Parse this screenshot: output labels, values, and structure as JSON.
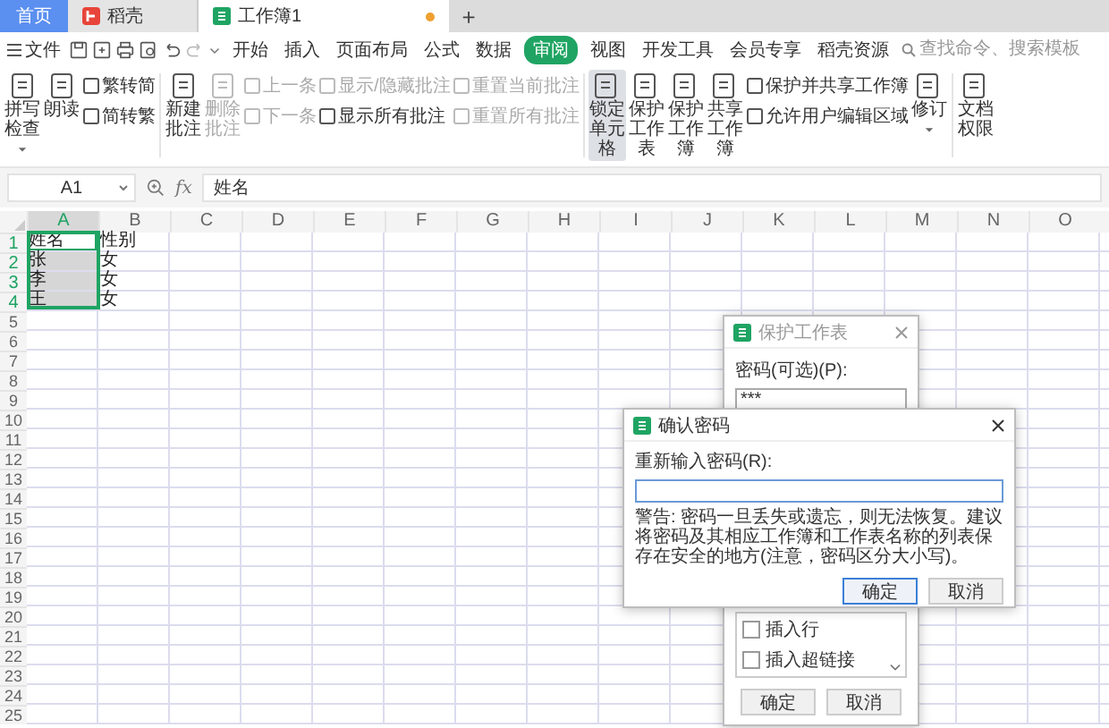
{
  "tabs": [
    {
      "label": "首页",
      "selected": false,
      "kind": "home"
    },
    {
      "label": "稻壳",
      "selected": false,
      "kind": "docer"
    },
    {
      "label": "工作簿1",
      "selected": true,
      "kind": "sheet",
      "unsaved": true
    }
  ],
  "new_tab": "+",
  "menu": {
    "file": "文件",
    "items": [
      {
        "label": "开始",
        "selected": false
      },
      {
        "label": "插入",
        "selected": false
      },
      {
        "label": "页面布局",
        "selected": false
      },
      {
        "label": "公式",
        "selected": false
      },
      {
        "label": "数据",
        "selected": false
      },
      {
        "label": "审阅",
        "selected": true
      },
      {
        "label": "视图",
        "selected": false
      },
      {
        "label": "开发工具",
        "selected": false
      },
      {
        "label": "会员专享",
        "selected": false
      },
      {
        "label": "稻壳资源",
        "selected": false
      }
    ],
    "search": {
      "placeholder": "查找命令、搜索模板"
    }
  },
  "ribbon": [
    {
      "items": [
        {
          "kind": "large",
          "label": "拼写检查",
          "dropdown": true,
          "disabled": false,
          "selected": false
        },
        {
          "kind": "large",
          "label": "朗读",
          "dropdown": false,
          "disabled": false,
          "selected": false
        },
        {
          "kind": "pair",
          "items": [
            {
              "label": "繁转简",
              "disabled": false
            },
            {
              "label": "简转繁",
              "disabled": false
            }
          ]
        }
      ]
    },
    {
      "items": [
        {
          "kind": "large",
          "label": "新建批注",
          "dropdown": false,
          "disabled": false,
          "selected": false
        },
        {
          "kind": "large",
          "label": "删除批注",
          "dropdown": false,
          "disabled": true,
          "selected": false
        },
        {
          "kind": "pair",
          "items": [
            {
              "label": "上一条",
              "disabled": true
            },
            {
              "label": "下一条",
              "disabled": true
            }
          ]
        },
        {
          "kind": "pair",
          "items": [
            {
              "label": "显示/隐藏批注",
              "disabled": true
            },
            {
              "label": "显示所有批注",
              "disabled": false
            }
          ]
        },
        {
          "kind": "pair",
          "items": [
            {
              "label": "重置当前批注",
              "disabled": true
            },
            {
              "label": "重置所有批注",
              "disabled": true
            }
          ]
        }
      ]
    },
    {
      "items": [
        {
          "kind": "large",
          "label": "锁定单元格",
          "dropdown": false,
          "disabled": false,
          "selected": true
        },
        {
          "kind": "large",
          "label": "保护工作表",
          "dropdown": false,
          "disabled": false,
          "selected": false
        },
        {
          "kind": "large",
          "label": "保护工作簿",
          "dropdown": false,
          "disabled": false,
          "selected": false
        },
        {
          "kind": "large",
          "label": "共享工作簿",
          "dropdown": false,
          "disabled": false,
          "selected": false
        },
        {
          "kind": "pair",
          "items": [
            {
              "label": "保护并共享工作簿",
              "disabled": false
            },
            {
              "label": "允许用户编辑区域",
              "disabled": false
            }
          ]
        },
        {
          "kind": "large",
          "label": "修订",
          "dropdown": true,
          "disabled": false,
          "selected": false
        }
      ]
    },
    {
      "items": [
        {
          "kind": "large",
          "label": "文档权限",
          "dropdown": false,
          "disabled": false,
          "selected": false
        }
      ]
    }
  ],
  "formula_bar": {
    "cell": "A1",
    "function_label": "fx",
    "value": "姓名"
  },
  "grid": {
    "columns": [
      {
        "label": "A",
        "selected": true
      },
      {
        "label": "B",
        "selected": false
      },
      {
        "label": "C",
        "selected": false
      },
      {
        "label": "D",
        "selected": false
      },
      {
        "label": "E",
        "selected": false
      },
      {
        "label": "F",
        "selected": false
      },
      {
        "label": "G",
        "selected": false
      },
      {
        "label": "H",
        "selected": false
      },
      {
        "label": "I",
        "selected": false
      },
      {
        "label": "J",
        "selected": false
      },
      {
        "label": "K",
        "selected": false
      },
      {
        "label": "L",
        "selected": false
      },
      {
        "label": "M",
        "selected": false
      },
      {
        "label": "N",
        "selected": false
      },
      {
        "label": "O",
        "selected": false
      }
    ],
    "rows": [
      {
        "label": "1",
        "selected": true,
        "cells": [
          {
            "text": "姓名",
            "selected": true,
            "active": true
          },
          {
            "text": "性别",
            "selected": false,
            "active": false
          }
        ]
      },
      {
        "label": "2",
        "selected": true,
        "cells": [
          {
            "text": "张",
            "selected": true,
            "active": false
          },
          {
            "text": "女",
            "selected": false,
            "active": false
          }
        ]
      },
      {
        "label": "3",
        "selected": true,
        "cells": [
          {
            "text": "李",
            "selected": true,
            "active": false
          },
          {
            "text": "女",
            "selected": false,
            "active": false
          }
        ]
      },
      {
        "label": "4",
        "selected": true,
        "cells": [
          {
            "text": "王",
            "selected": true,
            "active": false
          },
          {
            "text": "女",
            "selected": false,
            "active": false
          }
        ]
      },
      {
        "label": "5",
        "selected": false
      },
      {
        "label": "6",
        "selected": false
      },
      {
        "label": "7",
        "selected": false
      },
      {
        "label": "8",
        "selected": false
      },
      {
        "label": "9",
        "selected": false
      },
      {
        "label": "10",
        "selected": false
      },
      {
        "label": "11",
        "selected": false
      },
      {
        "label": "12",
        "selected": false
      },
      {
        "label": "13",
        "selected": false
      },
      {
        "label": "14",
        "selected": false
      },
      {
        "label": "15",
        "selected": false
      },
      {
        "label": "16",
        "selected": false
      },
      {
        "label": "17",
        "selected": false
      },
      {
        "label": "18",
        "selected": false
      },
      {
        "label": "19",
        "selected": false
      },
      {
        "label": "20",
        "selected": false
      },
      {
        "label": "21",
        "selected": false
      },
      {
        "label": "22",
        "selected": false
      },
      {
        "label": "23",
        "selected": false
      },
      {
        "label": "24",
        "selected": false
      },
      {
        "label": "25",
        "selected": false
      }
    ]
  },
  "protect_dialog": {
    "title": "保护工作表",
    "password_label": "密码(可选)(P):",
    "password": "***",
    "permissions": [
      {
        "label": "插入行",
        "checked": false
      },
      {
        "label": "插入超链接",
        "checked": false
      }
    ],
    "buttons": [
      "确定",
      "取消"
    ]
  },
  "confirm_dialog": {
    "title": "确认密码",
    "label": "重新输入密码(R):",
    "warning": "警告: 密码一旦丢失或遗忘，则无法恢复。建议将密码及其相应工作簿和工作表名称的列表保存在安全的地方(注意，密码区分大小写)。",
    "buttons": [
      {
        "label": "确定",
        "default": true
      },
      {
        "label": "取消",
        "default": false
      }
    ]
  }
}
